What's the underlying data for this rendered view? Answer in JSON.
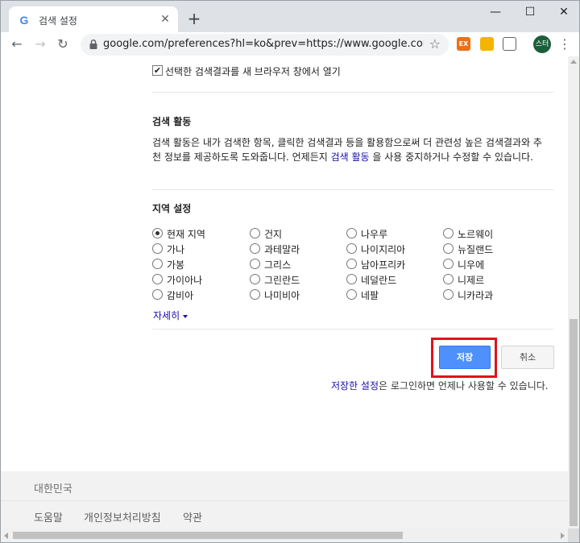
{
  "browser": {
    "tab_title": "검색 설정",
    "tab_favicon": "G",
    "new_tab": "+",
    "close": "✕",
    "url": "google.com/preferences?hl=ko&prev=https://www.google.com/sea...",
    "ext_label": "EX",
    "avatar_label": "스터",
    "colors": {
      "tabstrip": "#dee1e6",
      "omnibox": "#f1f3f4",
      "avatar": "#1b5e3a"
    }
  },
  "page": {
    "checkbox_label": "선택한 검색결과를 새 브라우저 창에서 열기",
    "activity": {
      "title": "검색 활동",
      "text_before": "검색 활동은 내가 검색한 항목, 클릭한 검색결과 등을 활용함으로써 더 관련성 높은 검색결과와 추천 정보를 제공하도록 도와줍니다. 언제든지 ",
      "link": "검색 활동",
      "text_after": " 을 사용 중지하거나 수정할 수 있습니다."
    },
    "region": {
      "title": "지역 설정",
      "selected": "현재 지역",
      "columns": [
        [
          "현재 지역",
          "가나",
          "가봉",
          "가이아나",
          "감비아"
        ],
        [
          "건지",
          "과테말라",
          "그리스",
          "그린란드",
          "나미비아"
        ],
        [
          "나우루",
          "나이지리아",
          "남아프리카",
          "네덜란드",
          "네팔"
        ],
        [
          "노르웨이",
          "뉴질랜드",
          "니우에",
          "니제르",
          "니카라과"
        ]
      ],
      "more": "자세히"
    },
    "save_label": "저장",
    "cancel_label": "취소",
    "saved_note_link": "저장한 설정",
    "saved_note_text": "은 로그인하면 언제나 사용할 수 있습니다.",
    "highlight_color": "#e0121b",
    "button_color": "#4d90fe"
  },
  "footer": {
    "country": "대한민국",
    "links": [
      "도움말",
      "개인정보처리방침",
      "약관"
    ]
  }
}
